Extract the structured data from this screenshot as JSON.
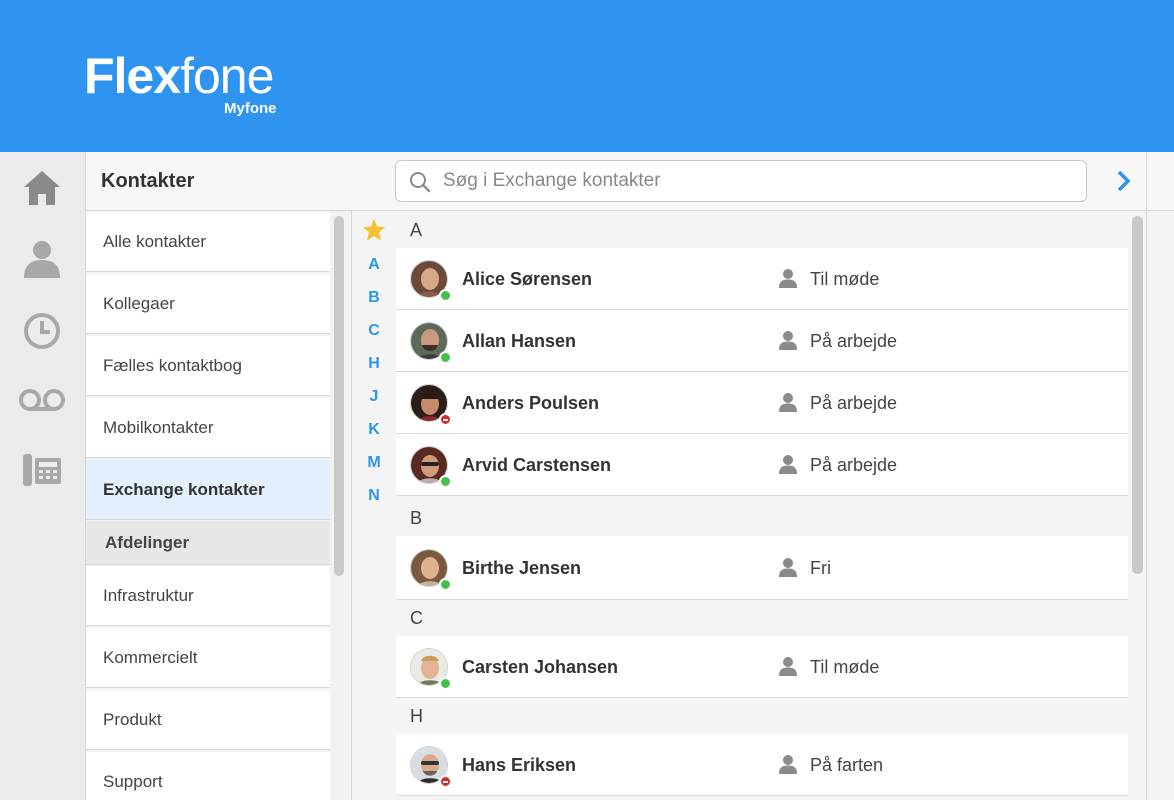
{
  "brand": {
    "name_bold": "Flex",
    "name_light": "fone",
    "product": "Myfone"
  },
  "colors": {
    "header": "#2f93f0",
    "accent": "#2f93f0",
    "online": "#45c04a",
    "busy": "#d9252b",
    "star": "#f2c230"
  },
  "rail": {
    "icons": [
      "home-icon",
      "user-icon",
      "clock-icon",
      "voicemail-icon",
      "desk-phone-icon"
    ]
  },
  "sidebar": {
    "title": "Kontakter",
    "items": [
      {
        "label": "Alle kontakter"
      },
      {
        "label": "Kollegaer"
      },
      {
        "label": "Fælles kontaktbog"
      },
      {
        "label": "Mobilkontakter"
      },
      {
        "label": "Exchange kontakter",
        "active": true
      }
    ],
    "section_label": "Afdelinger",
    "departments": [
      {
        "label": "Infrastruktur"
      },
      {
        "label": "Kommercielt"
      },
      {
        "label": "Produkt"
      },
      {
        "label": "Support"
      }
    ]
  },
  "search": {
    "placeholder": "Søg i Exchange kontakter",
    "value": ""
  },
  "alphabet": [
    "A",
    "B",
    "C",
    "H",
    "J",
    "K",
    "M",
    "N"
  ],
  "groups": [
    {
      "letter": "A",
      "contacts": [
        {
          "name": "Alice Sørensen",
          "status": "Til møde",
          "presence": "online"
        },
        {
          "name": "Allan Hansen",
          "status": "På arbejde",
          "presence": "online"
        },
        {
          "name": "Anders Poulsen",
          "status": "På arbejde",
          "presence": "busy"
        },
        {
          "name": "Arvid Carstensen",
          "status": "På arbejde",
          "presence": "online"
        }
      ]
    },
    {
      "letter": "B",
      "contacts": [
        {
          "name": "Birthe Jensen",
          "status": "Fri",
          "presence": "online"
        }
      ]
    },
    {
      "letter": "C",
      "contacts": [
        {
          "name": "Carsten Johansen",
          "status": "Til møde",
          "presence": "online"
        }
      ]
    },
    {
      "letter": "H",
      "contacts": [
        {
          "name": "Hans Eriksen",
          "status": "På farten",
          "presence": "busy"
        }
      ]
    }
  ]
}
